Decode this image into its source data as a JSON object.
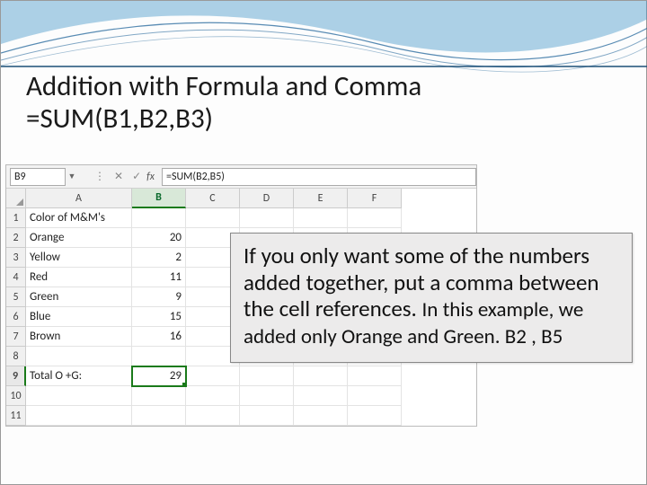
{
  "title": {
    "line1": "Addition with Formula and Comma",
    "line2": "=SUM(B1,B2,B3)"
  },
  "excel": {
    "namebox": "B9",
    "fx_label": "fx",
    "formula": "=SUM(B2,B5)",
    "columns": [
      "A",
      "B",
      "C",
      "D",
      "E",
      "F"
    ],
    "rows": [
      {
        "n": "1",
        "a": "Color of M&M's"
      },
      {
        "n": "2",
        "a": "Orange",
        "b": "20"
      },
      {
        "n": "3",
        "a": "Yellow",
        "b": "2"
      },
      {
        "n": "4",
        "a": "Red",
        "b": "11"
      },
      {
        "n": "5",
        "a": "Green",
        "b": "9"
      },
      {
        "n": "6",
        "a": "Blue",
        "b": "15"
      },
      {
        "n": "7",
        "a": "Brown",
        "b": "16"
      },
      {
        "n": "8"
      },
      {
        "n": "9",
        "a": "Total O +G:",
        "b": "29"
      },
      {
        "n": "10"
      },
      {
        "n": "11"
      }
    ]
  },
  "callout": {
    "part1": "If you only want some of the numbers added together, put a comma between the cell references. ",
    "part2": "In this example, we added only Orange and Green. B2 , B5"
  }
}
